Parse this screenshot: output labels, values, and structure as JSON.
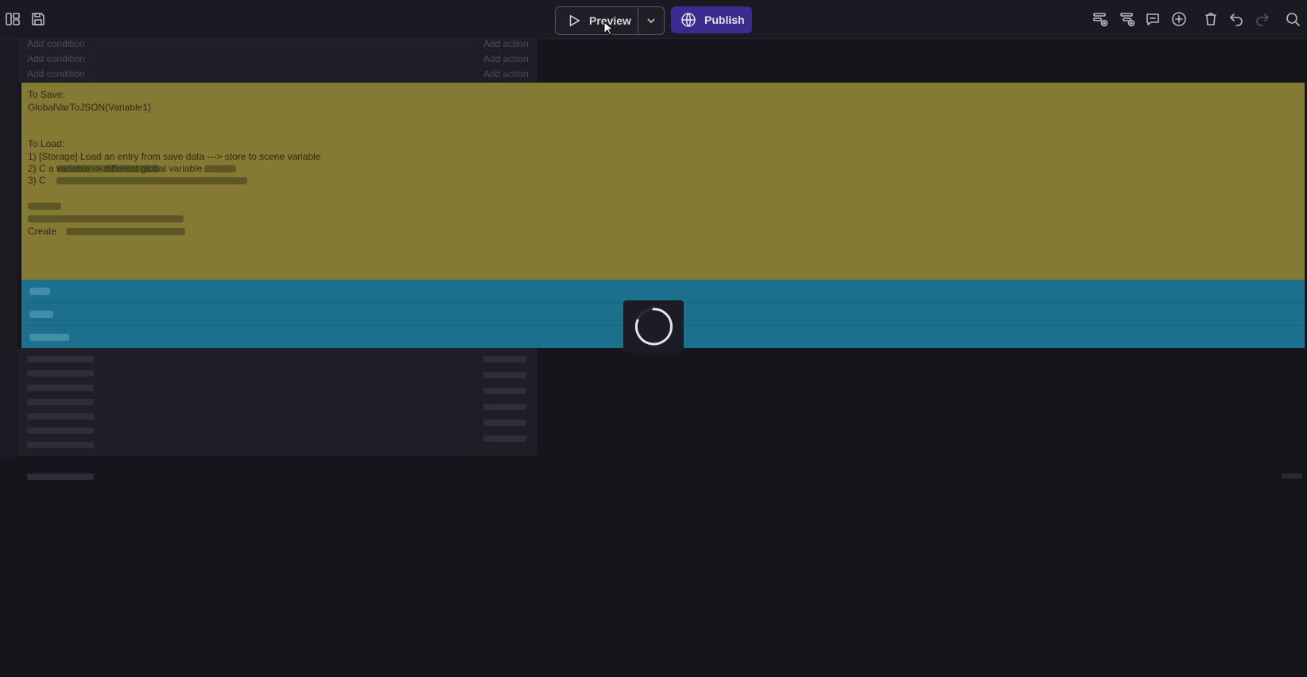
{
  "toolbar": {
    "preview_label": "Preview",
    "publish_label": "Publish",
    "left_icons": [
      "layout-panels-icon",
      "save-icon"
    ],
    "right_icons": [
      "add-event-icon",
      "add-sub-event-icon",
      "add-comment-icon",
      "add-icon",
      "delete-icon",
      "undo-icon",
      "redo-icon",
      "search-icon"
    ]
  },
  "events_top": {
    "conditions": [
      "Add condition",
      "Add condition",
      "Add condition"
    ],
    "actions": [
      "Add action",
      "Add action",
      "Add action"
    ]
  },
  "comment": {
    "lines": [
      "To Save:",
      "GlobalVarToJSON(Variable1)",
      "",
      "",
      "To Load:",
      "1) [Storage] Load an entry from save data ---> store to scene variable",
      "2) C                    a variable    ->           different global variable",
      "3) C                         ",
      "",
      "            ",
      "               ",
      "Create              "
    ],
    "color": "#857a34"
  },
  "blue_rows": {
    "color": "#1d6f8e"
  },
  "loading": {
    "icon": "spinner-icon"
  }
}
